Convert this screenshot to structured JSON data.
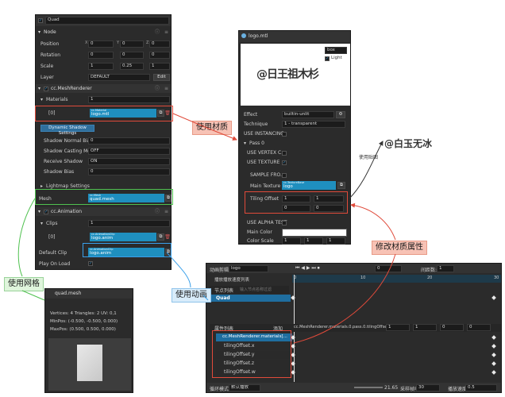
{
  "inspector": {
    "node_name": "Quad",
    "node_section": "Node",
    "position": {
      "label": "Position",
      "x": "0",
      "y": "0",
      "z": "0"
    },
    "rotation": {
      "label": "Rotation",
      "x": "0",
      "y": "0",
      "z": "0"
    },
    "scale": {
      "label": "Scale",
      "x": "1",
      "y": "0.25",
      "z": "1"
    },
    "layer": {
      "label": "Layer",
      "value": "DEFAULT",
      "edit": "Edit"
    },
    "mesh_renderer": "cc.MeshRenderer",
    "materials_label": "Materials",
    "materials_count": "1",
    "material_index": "[0]",
    "material_tag": "cc.Material",
    "material_value": "logo.mtl",
    "dynamic_shadow": "Dynamic Shadow Settings",
    "shadow_normal_bias": "Shadow Normal Bias",
    "shadow_normal_bias_value": "0",
    "shadow_casting_mode": "Shadow Casting Mode",
    "shadow_casting_value": "OFF",
    "receive_shadow": "Receive Shadow",
    "receive_shadow_value": "ON",
    "shadow_bias": "Shadow Bias",
    "shadow_bias_value": "0",
    "lightmap": "Lightmap Settings",
    "mesh_label": "Mesh",
    "mesh_tag": "cc.Mesh",
    "mesh_value": "quad.mesh",
    "animation": "cc.Animation",
    "clips_label": "Clips",
    "clips_count": "1",
    "clip_index": "[0]",
    "clip_tag": "cc.AnimationClip",
    "clip_value": "logo.anim",
    "default_clip_label": "Default Clip",
    "default_clip_tag": "cc.AnimationClip",
    "default_clip_value": "logo.anim",
    "play_on_load": "Play On Load"
  },
  "mesh_preview": {
    "title": "quad.mesh",
    "info1": "Vertices: 4   Triangles: 2   UV: 0,1",
    "info2": "MinPos: (-0.500, -0.500, 0.000)",
    "info3": "MaxPos: (0.500, 0.500, 0.000)"
  },
  "material": {
    "title": "logo.mtl",
    "preview_select": "box",
    "light_label": "Light",
    "effect_label": "Effect",
    "effect_value": "builtin-unlit",
    "technique_label": "Technique",
    "technique_value": "1 - transparent",
    "use_instancing": "USE INSTANCING",
    "pass": "Pass 0",
    "use_vertex": "USE VERTEX C...",
    "use_texture": "USE TEXTURE",
    "sample_from": "SAMPLE FRO...",
    "main_texture_label": "Main Texture",
    "main_texture_tag": "cc.TextureBase",
    "main_texture_value": "logo",
    "tiling_label": "Tiling Offset",
    "tiling_x": "1",
    "tiling_y": "1",
    "tiling_z": "0",
    "tiling_w": "0",
    "use_alpha_test": "USE ALPHA TEST",
    "main_color": "Main Color",
    "color_scale": "Color Scale",
    "color_scale_values": [
      "1",
      "1",
      "1"
    ],
    "preview_text": "@日王祖木杉"
  },
  "watermark": "@白玉无冰",
  "annotations": {
    "use_material": "使用材质",
    "use_texture": "使用贴图",
    "use_mesh": "使用网格",
    "use_animation": "使用动画",
    "modify_material": "修改材质属性"
  },
  "animation_editor": {
    "clip_label": "动画剪辑",
    "clip_value": "logo",
    "frame_value": "0",
    "spacing_label": "间距数:",
    "spacing_value": "1",
    "timeline_marks": [
      "0",
      "10",
      "20",
      "30"
    ],
    "node_list_label": "节点列表",
    "node_search_placeholder": "输入节点名称过滤",
    "node_item": "Quad",
    "props_label": "属性列表",
    "props_add": "添加",
    "prop_path": "cc.MeshRenderer.materials.0.pass.0.tilingOffset",
    "prop_values": [
      "1",
      "1",
      "0",
      "0"
    ],
    "prop_group": "cc.MeshRenderer.materials[...",
    "props": [
      "tilingOffset.x",
      "tilingOffset.y",
      "tilingOffset.z",
      "tilingOffset.w"
    ],
    "top_extra": "播放播放速度列表",
    "wrap_mode_label": "循环模式",
    "wrap_mode_value": "默认播放",
    "time_value": "21.65",
    "sample_label": "采样帧率:",
    "sample_value": "30",
    "speed_label": "播放速度:",
    "speed_value": "0.5"
  }
}
